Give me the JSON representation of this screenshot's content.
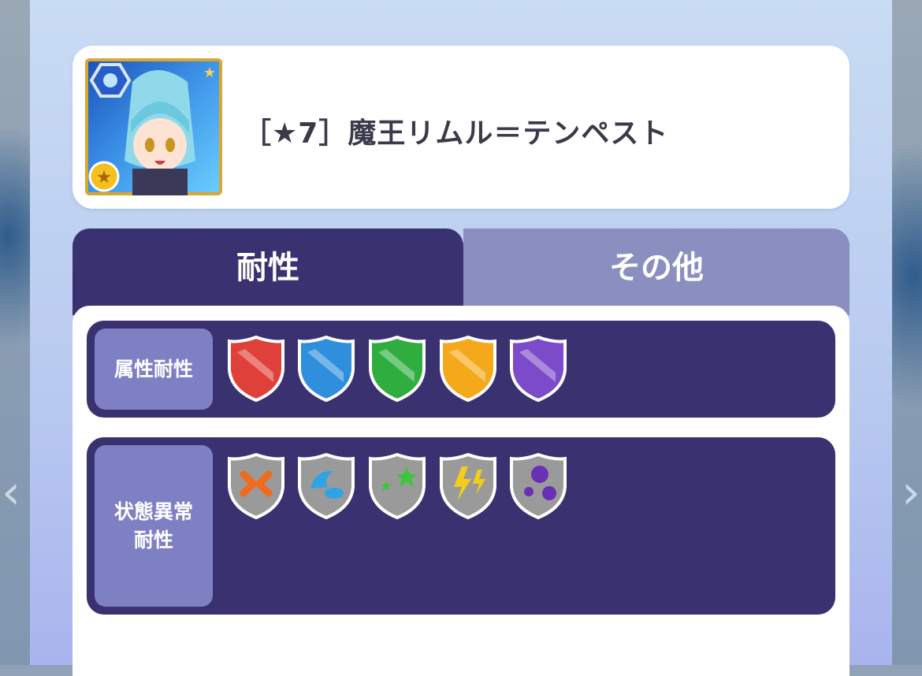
{
  "character": {
    "name": "［★7］魔王リムル＝テンペスト",
    "portrait_icon": "rimuru-portrait-icon"
  },
  "tabs": [
    {
      "label": "耐性",
      "active": true
    },
    {
      "label": "その他",
      "active": false
    }
  ],
  "attribute_resistance": {
    "label": "属性耐性",
    "shields": [
      {
        "icon": "fire-shield-icon",
        "color": "#e0403a"
      },
      {
        "icon": "water-shield-icon",
        "color": "#2f8fdc"
      },
      {
        "icon": "wind-shield-icon",
        "color": "#2fae3f"
      },
      {
        "icon": "light-shield-icon",
        "color": "#f3a91a"
      },
      {
        "icon": "dark-shield-icon",
        "color": "#7c4bc9"
      }
    ]
  },
  "status_resistance": {
    "label_line1": "状態異常",
    "label_line2": "耐性",
    "shields": [
      {
        "icon": "anger-shield-icon"
      },
      {
        "icon": "sleep-shield-icon"
      },
      {
        "icon": "confusion-shield-icon"
      },
      {
        "icon": "paralysis-shield-icon"
      },
      {
        "icon": "poison-shield-icon"
      }
    ]
  },
  "colors": {
    "panel_dark": "#3a3270",
    "label_bg": "#7f80c4",
    "tab_inactive": "#8a8fbf"
  }
}
